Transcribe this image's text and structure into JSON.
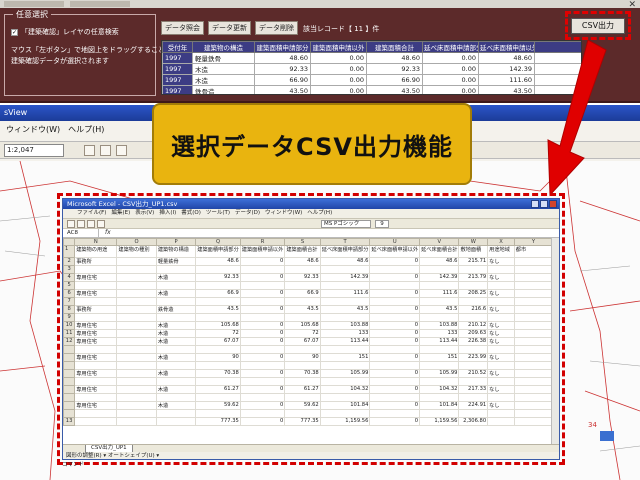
{
  "top_panel": {
    "group_title": "任意選択",
    "checkbox_label": "「建築確認」レイヤの任意検索",
    "checked": true,
    "description": [
      "マウス「左ボタン」で地図上をドラッグすることで",
      "建築確認データが選択されます"
    ],
    "buttons": [
      "データ照会",
      "データ更新",
      "データ削除"
    ],
    "record_count": "該当レコード【 11 】件",
    "csv_button": "CSV出力",
    "grid_headers": [
      "受付年",
      "建築物の構造",
      "建築面積申請部分",
      "建築面積申請以外",
      "建築面積合計",
      "延べ床面積申請部分",
      "延べ床面積申請以外"
    ],
    "grid_rows": [
      [
        "1997",
        "軽量鉄骨",
        "48.60",
        "0.00",
        "48.60",
        "0.00",
        "48.60"
      ],
      [
        "1997",
        "木造",
        "92.33",
        "0.00",
        "92.33",
        "0.00",
        "142.39"
      ],
      [
        "1997",
        "木造",
        "66.90",
        "0.00",
        "66.90",
        "0.00",
        "111.60"
      ],
      [
        "1997",
        "鉄骨造",
        "43.50",
        "0.00",
        "43.50",
        "0.00",
        "43.50"
      ],
      [
        "1997",
        "木造",
        "105.68",
        "0.00",
        "105.68",
        "0.00",
        "105.68"
      ]
    ]
  },
  "banner": {
    "text": "選択データCSV出力機能"
  },
  "gis": {
    "title": "sView",
    "menu": [
      "ウィンドウ(W)",
      "ヘルプ(H)"
    ],
    "scale": "1:2,047"
  },
  "excel": {
    "title": "Microsoft Excel - CSV出力_UP1.csv",
    "menu": [
      "ファイル(F)",
      "編集(E)",
      "表示(V)",
      "挿入(I)",
      "書式(O)",
      "ツール(T)",
      "データ(D)",
      "ウィンドウ(W)",
      "ヘルプ(H)"
    ],
    "cell_ref": "AC8",
    "fx": "fx",
    "font_name": "MS Pゴシック",
    "font_size": "9",
    "columns": [
      "",
      "N",
      "O",
      "P",
      "Q",
      "R",
      "S",
      "T",
      "U",
      "V",
      "W",
      "X",
      "Y"
    ],
    "rows": [
      {
        "n": "1",
        "hdr": true,
        "cells": [
          "建築物の用途",
          "建築物の種別",
          "建築物の構造",
          "建築面積申請部分",
          "建築面積申請以外",
          "建築面積合計",
          "延べ床面積申請部分",
          "延べ床面積申請以外",
          "延べ床面積合計",
          "敷地面積",
          "用途地域",
          "都市"
        ]
      },
      {
        "n": "2",
        "cells": [
          "事務所",
          "",
          "軽量鉄骨",
          "48.6",
          "0",
          "48.6",
          "48.6",
          "0",
          "48.6",
          "215.71",
          "なし",
          ""
        ]
      },
      {
        "n": "3",
        "cells": [
          "",
          "",
          "",
          "",
          "",
          "",
          "",
          "",
          "",
          "",
          "",
          ""
        ]
      },
      {
        "n": "4",
        "cells": [
          "専用住宅",
          "",
          "木造",
          "92.33",
          "0",
          "92.33",
          "142.39",
          "0",
          "142.39",
          "213.79",
          "なし",
          ""
        ]
      },
      {
        "n": "5",
        "cells": [
          "",
          "",
          "",
          "",
          "",
          "",
          "",
          "",
          "",
          "",
          "",
          ""
        ]
      },
      {
        "n": "6",
        "cells": [
          "専用住宅",
          "",
          "木造",
          "66.9",
          "0",
          "66.9",
          "111.6",
          "0",
          "111.6",
          "208.25",
          "なし",
          ""
        ]
      },
      {
        "n": "7",
        "cells": [
          "",
          "",
          "",
          "",
          "",
          "",
          "",
          "",
          "",
          "",
          "",
          ""
        ]
      },
      {
        "n": "8",
        "cells": [
          "事務所",
          "",
          "鉄骨造",
          "43.5",
          "0",
          "43.5",
          "43.5",
          "0",
          "43.5",
          "216.6",
          "なし",
          ""
        ]
      },
      {
        "n": "9",
        "cells": [
          "",
          "",
          "",
          "",
          "",
          "",
          "",
          "",
          "",
          "",
          "",
          ""
        ]
      },
      {
        "n": "10",
        "cells": [
          "専用住宅",
          "",
          "木造",
          "105.68",
          "0",
          "105.68",
          "103.88",
          "0",
          "103.88",
          "210.12",
          "なし",
          ""
        ]
      },
      {
        "n": "11",
        "cells": [
          "専用住宅",
          "",
          "木造",
          "72",
          "0",
          "72",
          "133",
          "0",
          "133",
          "209.63",
          "なし",
          ""
        ]
      },
      {
        "n": "12",
        "cells": [
          "専用住宅",
          "",
          "木造",
          "67.07",
          "0",
          "67.07",
          "113.44",
          "0",
          "113.44",
          "226.38",
          "なし",
          ""
        ]
      },
      {
        "n": "",
        "cells": [
          "",
          "",
          "",
          "",
          "",
          "",
          "",
          "",
          "",
          "",
          "",
          ""
        ]
      },
      {
        "n": "",
        "cells": [
          "専用住宅",
          "",
          "木造",
          "90",
          "0",
          "90",
          "151",
          "0",
          "151",
          "223.99",
          "なし",
          ""
        ]
      },
      {
        "n": "",
        "cells": [
          "",
          "",
          "",
          "",
          "",
          "",
          "",
          "",
          "",
          "",
          "",
          ""
        ]
      },
      {
        "n": "",
        "cells": [
          "専用住宅",
          "",
          "木造",
          "70.38",
          "0",
          "70.38",
          "105.99",
          "0",
          "105.99",
          "210.52",
          "なし",
          ""
        ]
      },
      {
        "n": "",
        "cells": [
          "",
          "",
          "",
          "",
          "",
          "",
          "",
          "",
          "",
          "",
          "",
          ""
        ]
      },
      {
        "n": "",
        "cells": [
          "専用住宅",
          "",
          "木造",
          "61.27",
          "0",
          "61.27",
          "104.32",
          "0",
          "104.32",
          "217.33",
          "なし",
          ""
        ]
      },
      {
        "n": "",
        "cells": [
          "",
          "",
          "",
          "",
          "",
          "",
          "",
          "",
          "",
          "",
          "",
          ""
        ]
      },
      {
        "n": "",
        "cells": [
          "専用住宅",
          "",
          "木造",
          "59.62",
          "0",
          "59.62",
          "101.84",
          "0",
          "101.84",
          "224.91",
          "なし",
          ""
        ]
      },
      {
        "n": "",
        "cells": [
          "",
          "",
          "",
          "",
          "",
          "",
          "",
          "",
          "",
          "",
          "",
          ""
        ]
      },
      {
        "n": "13",
        "cells": [
          "",
          "",
          "",
          "777.35",
          "0",
          "777.35",
          "1,159.56",
          "0",
          "1,159.56",
          "2,306.80",
          "",
          ""
        ]
      }
    ],
    "sheet_tab": "CSV出力_UP1",
    "draw_bar": "図形の調整(R) ▾  オートシェイプ(U) ▾",
    "status": "コマンド"
  },
  "colors": {
    "panel": "#5c2a2a",
    "grid_header": "#3c3c84",
    "banner": "#e9b40f",
    "highlight": "#e00000",
    "excel_title": "#2146a8"
  }
}
